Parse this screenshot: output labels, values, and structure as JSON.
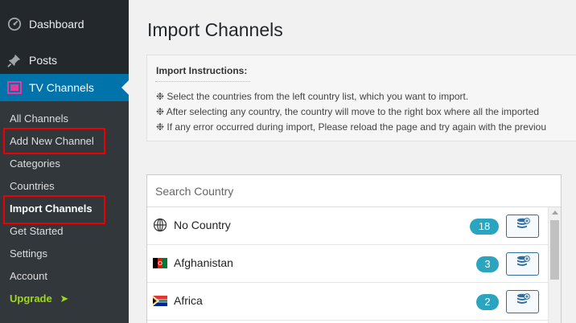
{
  "sidebar": {
    "dashboard_label": "Dashboard",
    "posts_label": "Posts",
    "tv_channels_label": "TV Channels",
    "submenu": {
      "all_channels": "All Channels",
      "add_new_channel": "Add New Channel",
      "categories": "Categories",
      "countries": "Countries",
      "import_channels": "Import Channels",
      "get_started": "Get Started",
      "settings": "Settings",
      "account": "Account",
      "upgrade": "Upgrade"
    }
  },
  "page": {
    "title": "Import Channels"
  },
  "instructions": {
    "heading": "Import Instructions:",
    "lines": [
      "❉ Select the countries from the left country list, which you want to import.",
      "❉ After selecting any country, the country will move to the right box where all the imported",
      "❉ If any error occurred during import, Please reload the page and try again with the previou"
    ]
  },
  "country_list": {
    "search_placeholder": "Search Country",
    "rows": [
      {
        "name": "No Country",
        "count": "18",
        "flag": "globe-icon"
      },
      {
        "name": "Afghanistan",
        "count": "3",
        "flag": "afghanistan-flag"
      },
      {
        "name": "Africa",
        "count": "2",
        "flag": "south-africa-flag"
      }
    ]
  },
  "colors": {
    "sidebar_bg": "#23282d",
    "submenu_bg": "#32373c",
    "accent": "#0073aa",
    "badge": "#2ba5bf",
    "upgrade": "#9fd90f",
    "highlight_box": "#e00000"
  }
}
